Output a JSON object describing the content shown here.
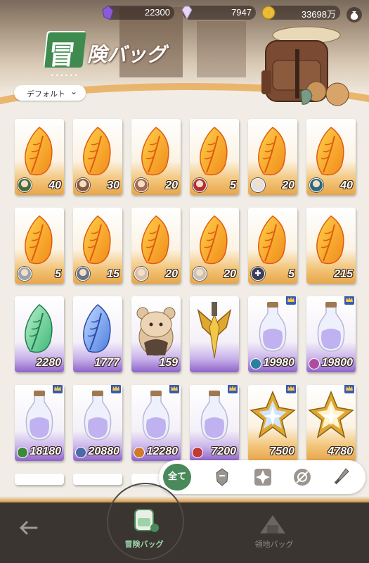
{
  "header": {
    "title": "険バッグ",
    "title_badge": "冒",
    "title_dots": "••••••",
    "sort_label": "デフォルト",
    "currencies": [
      {
        "icon": "purple-crystal-icon",
        "value": "22300"
      },
      {
        "icon": "diamond-icon",
        "value": "7947"
      },
      {
        "icon": "gold-coin-icon",
        "value": "33698万"
      }
    ]
  },
  "items": [
    {
      "type": "feather-gold",
      "qty": "40",
      "badge": "avatar",
      "color": "#4a6a3c"
    },
    {
      "type": "feather-gold",
      "qty": "30",
      "badge": "avatar",
      "color": "#8a5a3a"
    },
    {
      "type": "feather-gold",
      "qty": "20",
      "badge": "avatar",
      "color": "#a86a4a"
    },
    {
      "type": "feather-gold",
      "qty": "5",
      "badge": "avatar",
      "color": "#b43030"
    },
    {
      "type": "feather-gold",
      "qty": "20",
      "badge": "avatar",
      "color": "#e0e0e6"
    },
    {
      "type": "feather-gold",
      "qty": "40",
      "badge": "avatar",
      "color": "#2a6a7a"
    },
    {
      "type": "feather-gold",
      "qty": "5",
      "badge": "avatar",
      "color": "#9aa4a8"
    },
    {
      "type": "feather-gold",
      "qty": "15",
      "badge": "avatar",
      "color": "#6a7484"
    },
    {
      "type": "feather-gold",
      "qty": "20",
      "badge": "avatar",
      "color": "#d8c0a8"
    },
    {
      "type": "feather-gold",
      "qty": "20",
      "badge": "avatar",
      "color": "#c8c0b8"
    },
    {
      "type": "feather-gold",
      "qty": "5",
      "badge": "puzzle",
      "color": "#3d3d55"
    },
    {
      "type": "feather-gold",
      "qty": "215",
      "badge": "none",
      "color": ""
    },
    {
      "type": "feather-green",
      "qty": "2280",
      "badge": "none",
      "color": ""
    },
    {
      "type": "feather-blue",
      "qty": "1777",
      "badge": "none",
      "color": ""
    },
    {
      "type": "hamster",
      "qty": "159",
      "badge": "none",
      "color": ""
    },
    {
      "type": "emblem",
      "qty": "",
      "badge": "none",
      "color": ""
    },
    {
      "type": "potion",
      "qty": "19980",
      "badge": "elem",
      "color": "#2d7fa0",
      "crown": true
    },
    {
      "type": "potion",
      "qty": "19800",
      "badge": "elem",
      "color": "#b04aa0",
      "crown": true
    },
    {
      "type": "potion",
      "qty": "18180",
      "badge": "elem",
      "color": "#3a8a3a",
      "crown": true
    },
    {
      "type": "potion",
      "qty": "20880",
      "badge": "elem",
      "color": "#4a6aa8",
      "crown": true
    },
    {
      "type": "potion",
      "qty": "12280",
      "badge": "elem",
      "color": "#d07a2a",
      "crown": true
    },
    {
      "type": "potion",
      "qty": "7200",
      "badge": "elem",
      "color": "#c03a3a",
      "crown": true
    },
    {
      "type": "star-badge-blue",
      "qty": "7500",
      "badge": "none",
      "color": "",
      "crown": true
    },
    {
      "type": "star-badge-gold",
      "qty": "4780",
      "badge": "none",
      "color": "",
      "crown": true
    }
  ],
  "filters": {
    "all_label": "全て",
    "icons": [
      "warrior-helmet-icon",
      "compass-star-icon",
      "target-arrow-icon",
      "sword-icon"
    ]
  },
  "bottom_nav": {
    "adventure_label": "冒険バッグ",
    "territory_label": "領地バッグ"
  }
}
